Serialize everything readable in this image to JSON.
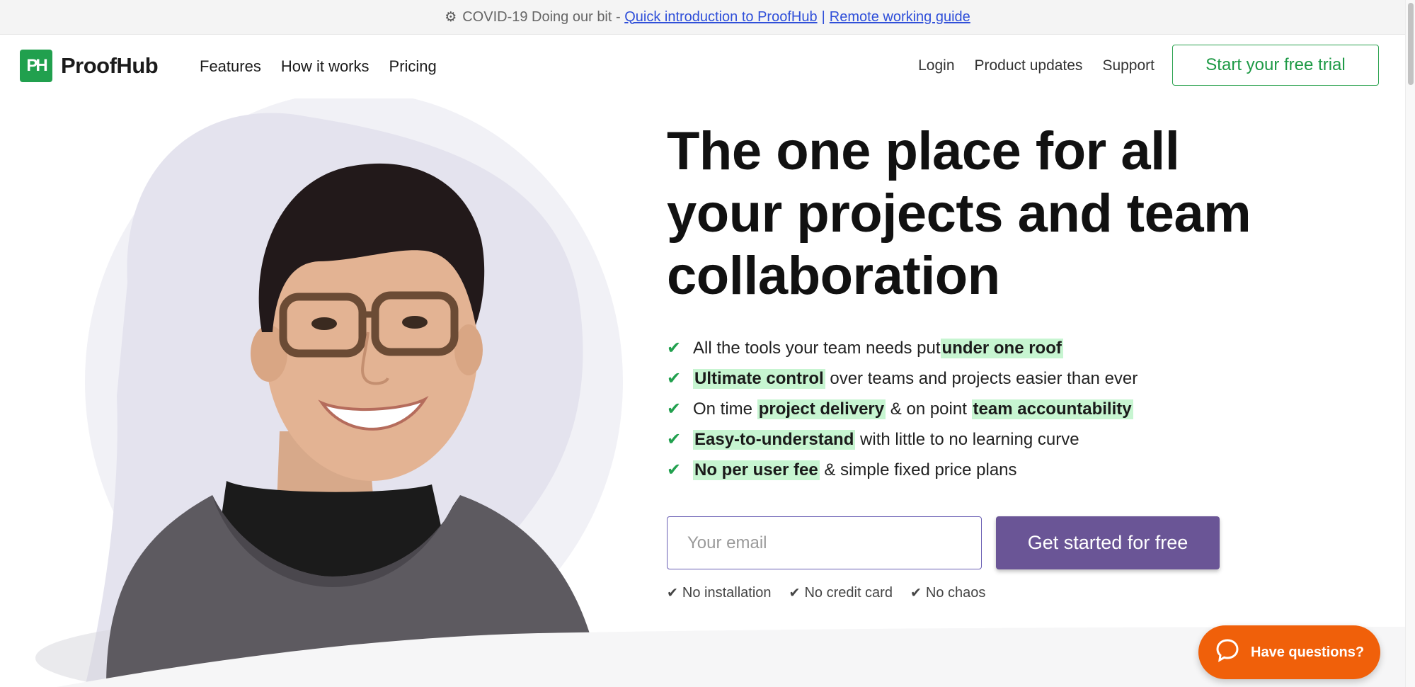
{
  "banner": {
    "icon": "virus-icon",
    "text": "COVID-19 Doing our bit -",
    "link1": "Quick introduction to ProofHub",
    "separator": "|",
    "link2": "Remote working guide"
  },
  "header": {
    "logo_mark": "PH",
    "logo_text": "ProofHub",
    "nav_left": [
      "Features",
      "How it works",
      "Pricing"
    ],
    "nav_right": [
      "Login",
      "Product updates",
      "Support"
    ],
    "trial_button": "Start your free trial"
  },
  "hero": {
    "headline": "The one place for all your projects and team collaboration",
    "features": [
      {
        "before": "All the tools your team needs put ",
        "highlight": "under one roof",
        "after": ""
      },
      {
        "before": "",
        "highlight": "Ultimate control",
        "after": " over teams and projects easier than ever"
      },
      {
        "before": "On time ",
        "highlight": "project delivery",
        "middle": " & on point ",
        "highlight2": "team accountability",
        "after": ""
      },
      {
        "before": "",
        "highlight": "Easy-to-understand",
        "after": " with little to no learning curve"
      },
      {
        "before": "",
        "highlight": "No per user fee",
        "after": " & simple fixed price plans"
      }
    ],
    "email_placeholder": "Your email",
    "cta_button": "Get started for free",
    "perks": [
      "No installation",
      "No credit card",
      "No chaos"
    ]
  },
  "chat": {
    "label": "Have questions?",
    "icon": "chat-bubble-icon"
  },
  "colors": {
    "brand_green": "#21a04e",
    "highlight": "#c7f5d1",
    "cta_purple": "#6a5596",
    "chat_orange": "#f0600a",
    "link_blue": "#2f4fd9"
  }
}
